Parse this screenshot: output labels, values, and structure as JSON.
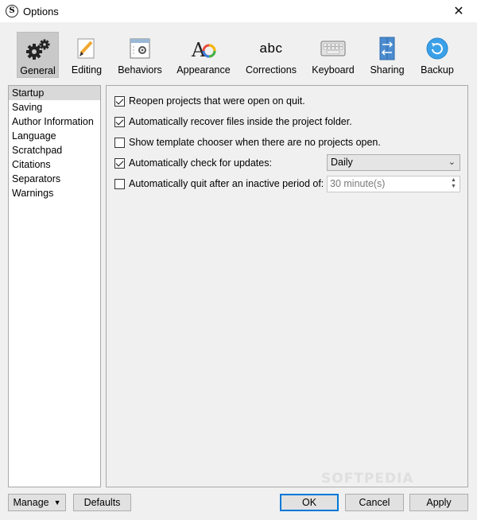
{
  "window": {
    "title": "Options",
    "close_glyph": "✕"
  },
  "toolbar": {
    "items": [
      {
        "label": "General",
        "icon": "gears-icon",
        "selected": true
      },
      {
        "label": "Editing",
        "icon": "pencil-icon"
      },
      {
        "label": "Behaviors",
        "icon": "behaviors-icon"
      },
      {
        "label": "Appearance",
        "icon": "appearance-icon"
      },
      {
        "label": "Corrections",
        "icon": "corrections-icon",
        "icon_text": "abc"
      },
      {
        "label": "Keyboard",
        "icon": "keyboard-icon"
      },
      {
        "label": "Sharing",
        "icon": "sharing-icon"
      },
      {
        "label": "Backup",
        "icon": "backup-icon"
      }
    ]
  },
  "sidebar": {
    "items": [
      {
        "label": "Startup",
        "selected": true
      },
      {
        "label": "Saving"
      },
      {
        "label": "Author Information"
      },
      {
        "label": "Language"
      },
      {
        "label": "Scratchpad"
      },
      {
        "label": "Citations"
      },
      {
        "label": "Separators"
      },
      {
        "label": "Warnings"
      }
    ]
  },
  "startup": {
    "reopen": {
      "label": "Reopen projects that were open on quit.",
      "checked": true
    },
    "recover": {
      "label": "Automatically recover files inside the project folder.",
      "checked": true
    },
    "template": {
      "label": "Show template chooser when there are no projects open.",
      "checked": false
    },
    "updates": {
      "label": "Automatically check for updates:",
      "checked": true,
      "value": "Daily"
    },
    "autoquit": {
      "label": "Automatically quit after an inactive period of:",
      "checked": false,
      "value": "30 minute(s)"
    }
  },
  "buttons": {
    "manage": "Manage",
    "manage_arrow": "▼",
    "defaults": "Defaults",
    "ok": "OK",
    "cancel": "Cancel",
    "apply": "Apply"
  },
  "watermark": "SOFTPEDIA",
  "colors": {
    "accent": "#0078d7",
    "selected_bg": "#c9c9c9",
    "backup_blue": "#3aa0e8"
  }
}
